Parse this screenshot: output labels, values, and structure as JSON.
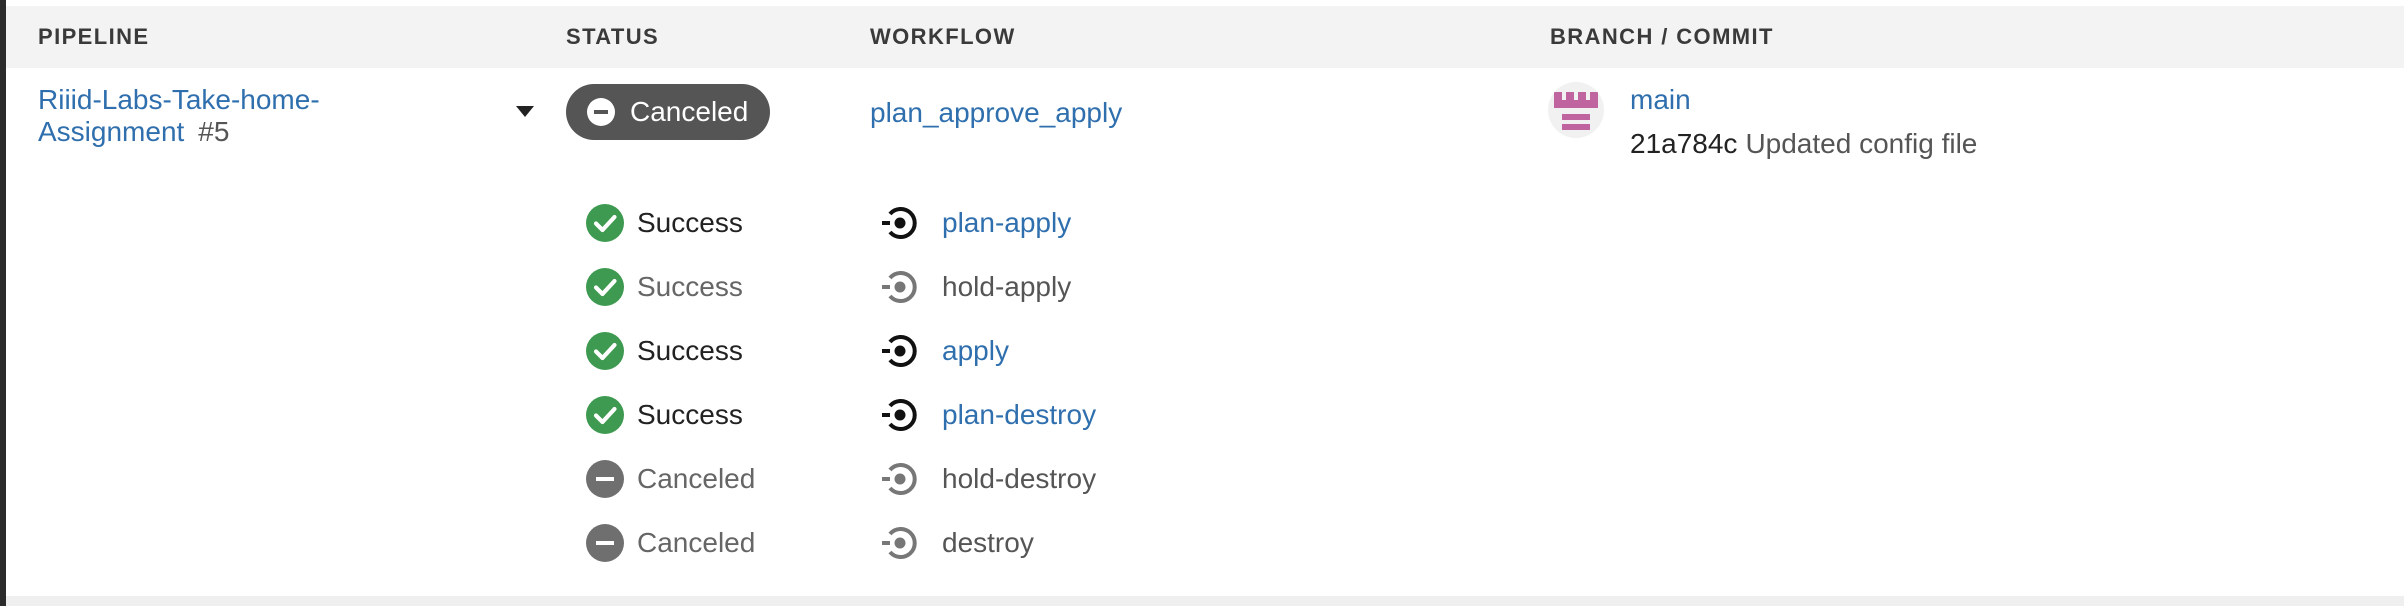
{
  "columns": {
    "pipeline": "PIPELINE",
    "status": "STATUS",
    "workflow": "WORKFLOW",
    "branch_commit": "BRANCH / COMMIT"
  },
  "pipeline": {
    "name_line1": "Riiid-Labs-Take-home-",
    "name_line2": "Assignment",
    "number": "#5",
    "status": "Canceled",
    "workflow": "plan_approve_apply",
    "branch": "main",
    "commit_hash": "21a784c",
    "commit_message": "Updated config file"
  },
  "jobs": [
    {
      "status": "Success",
      "name": "plan-apply"
    },
    {
      "status": "Success",
      "name": "hold-apply"
    },
    {
      "status": "Success",
      "name": "apply"
    },
    {
      "status": "Success",
      "name": "plan-destroy"
    },
    {
      "status": "Canceled",
      "name": "hold-destroy"
    },
    {
      "status": "Canceled",
      "name": "destroy"
    }
  ],
  "colors": {
    "link": "#2f6fae",
    "success": "#3d9a50",
    "canceled": "#6f6f6f",
    "pill": "#555555",
    "avatar": "#c064a0"
  },
  "icons": {
    "success": "check-circle-icon",
    "canceled": "minus-circle-icon",
    "job": "job-ring-icon",
    "dropdown": "caret-down-icon"
  }
}
